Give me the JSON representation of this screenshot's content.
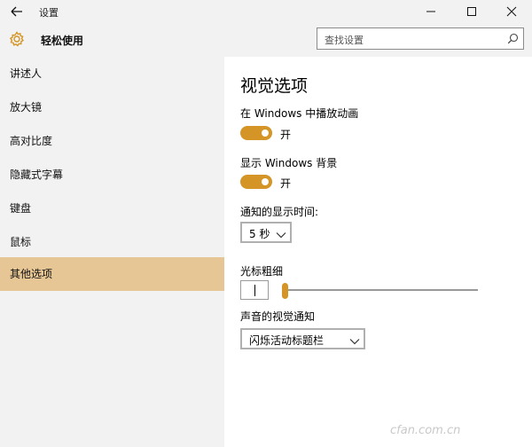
{
  "window": {
    "title": "设置"
  },
  "app": {
    "name": "轻松使用"
  },
  "search": {
    "placeholder": "查找设置"
  },
  "sidebar": {
    "items": [
      {
        "label": "讲述人"
      },
      {
        "label": "放大镜"
      },
      {
        "label": "高对比度"
      },
      {
        "label": "隐藏式字幕"
      },
      {
        "label": "键盘"
      },
      {
        "label": "鼠标"
      },
      {
        "label": "其他选项",
        "active": true
      }
    ]
  },
  "main": {
    "title": "视觉选项",
    "animations": {
      "label": "在 Windows 中播放动画",
      "state_label": "开",
      "on": true
    },
    "background": {
      "label": "显示 Windows 背景",
      "state_label": "开",
      "on": true
    },
    "notification": {
      "label": "通知的显示时间:",
      "value": "5 秒"
    },
    "cursor": {
      "label": "光标粗细",
      "thickness_level": 0.0
    },
    "visual_notification": {
      "label": "声音的视觉通知",
      "value": "闪烁活动标题栏"
    }
  },
  "colors": {
    "accent": "#d49526",
    "selected_nav": "#e6c694",
    "sidebar_bg": "#f2f2f2"
  },
  "icons": {
    "back": "back-arrow-icon",
    "app": "gear-icon",
    "search": "search-icon"
  },
  "watermark": {
    "text": "cfan.com.cn"
  }
}
